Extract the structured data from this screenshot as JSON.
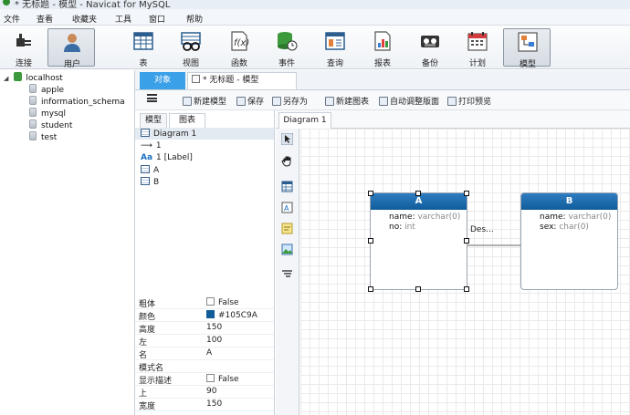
{
  "window": {
    "title": "* 无标题 - 模型 - Navicat for MySQL"
  },
  "menu": [
    "文件",
    "查看",
    "收藏夹",
    "工具",
    "窗口",
    "帮助"
  ],
  "toolbar": [
    {
      "label": "连接",
      "icon": "plug-icon"
    },
    {
      "label": "用户",
      "icon": "user-icon",
      "active": true
    },
    {
      "label": "表",
      "icon": "table-icon"
    },
    {
      "label": "视图",
      "icon": "view-icon"
    },
    {
      "label": "函数",
      "icon": "function-icon"
    },
    {
      "label": "事件",
      "icon": "event-icon"
    },
    {
      "label": "查询",
      "icon": "query-icon"
    },
    {
      "label": "报表",
      "icon": "report-icon"
    },
    {
      "label": "备份",
      "icon": "backup-icon"
    },
    {
      "label": "计划",
      "icon": "schedule-icon"
    },
    {
      "label": "模型",
      "icon": "model-icon",
      "active": true
    }
  ],
  "tree": {
    "connection": "localhost",
    "databases": [
      "apple",
      "information_schema",
      "mysql",
      "student",
      "test"
    ]
  },
  "tabs": {
    "objects": "对象",
    "model": "* 无标题 - 模型"
  },
  "design_toolbar": {
    "new_model": "新建模型",
    "save": "保存",
    "save_as": "另存为",
    "new_diagram": "新建图表",
    "auto_layout": "自动调整版面",
    "print_preview": "打印预览"
  },
  "side_tabs": {
    "model": "模型",
    "diagram": "图表"
  },
  "diagram_items": {
    "root": "Diagram 1",
    "relation": "1",
    "label": "1 [Label]",
    "tables": [
      "A",
      "B"
    ]
  },
  "properties": [
    {
      "key": "粗体",
      "value": "False",
      "type": "checkbox"
    },
    {
      "key": "颜色",
      "value": "#105C9A",
      "type": "color"
    },
    {
      "key": "高度",
      "value": "150"
    },
    {
      "key": "左",
      "value": "100"
    },
    {
      "key": "名",
      "value": "A"
    },
    {
      "key": "模式名",
      "value": ""
    },
    {
      "key": "显示描述",
      "value": "False",
      "type": "checkbox"
    },
    {
      "key": "上",
      "value": "90"
    },
    {
      "key": "宽度",
      "value": "150"
    }
  ],
  "canvas_tab": "Diagram 1",
  "entities": {
    "a": {
      "name": "A",
      "fields": [
        {
          "name": "name",
          "type": "varchar(0)"
        },
        {
          "name": "no",
          "type": "int"
        }
      ]
    },
    "b": {
      "name": "B",
      "fields": [
        {
          "name": "name",
          "type": "varchar(0)"
        },
        {
          "name": "sex",
          "type": "char(0)"
        }
      ]
    }
  },
  "relation_label": "Des...",
  "colors": {
    "accent": "#3aa0e8",
    "entity_header": "#105C9A"
  }
}
